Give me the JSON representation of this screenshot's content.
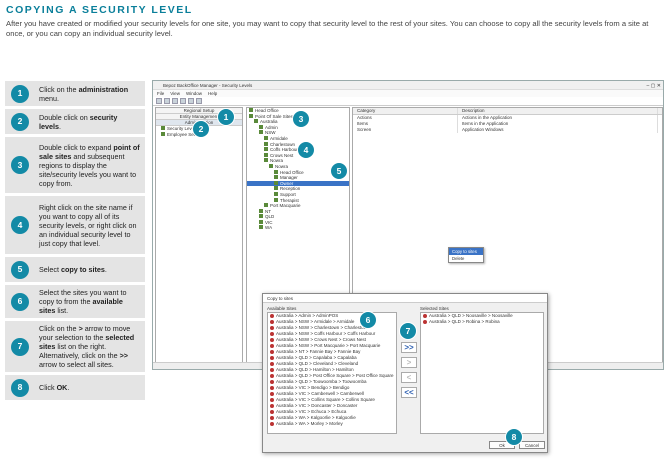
{
  "title": "COPYING A SECURITY LEVEL",
  "intro": "After you have created or modified your security levels for one site, you may want to copy that security level to the rest of your sites. You can choose to copy all the security levels from a site at once, or you can copy an individual security level.",
  "steps": [
    {
      "num": "1",
      "parts": [
        {
          "t": "Click on the "
        },
        {
          "t": "administration",
          "b": true
        },
        {
          "t": " menu."
        }
      ]
    },
    {
      "num": "2",
      "parts": [
        {
          "t": "Double click on "
        },
        {
          "t": "security levels",
          "b": true
        },
        {
          "t": "."
        }
      ]
    },
    {
      "num": "3",
      "parts": [
        {
          "t": "Double click to expand "
        },
        {
          "t": "point of sale sites",
          "b": true
        },
        {
          "t": " and subsequent regions to display the site/security levels you want to copy from."
        }
      ]
    },
    {
      "num": "4",
      "parts": [
        {
          "t": "Right click on the site name if you want to copy all of its security levels, or right click on an individual security level to just copy that level."
        }
      ]
    },
    {
      "num": "5",
      "parts": [
        {
          "t": "Select "
        },
        {
          "t": "copy to sites",
          "b": true
        },
        {
          "t": "."
        }
      ]
    },
    {
      "num": "6",
      "parts": [
        {
          "t": "Select the sites you want to copy to from the "
        },
        {
          "t": "available sites",
          "b": true
        },
        {
          "t": " list."
        }
      ]
    },
    {
      "num": "7",
      "parts": [
        {
          "t": "Click on the "
        },
        {
          "t": ">",
          "b": true
        },
        {
          "t": " arrow to move your selection to the "
        },
        {
          "t": "selected sites",
          "b": true
        },
        {
          "t": " list on the right. Alternatively, click on the "
        },
        {
          "t": ">>",
          "b": true
        },
        {
          "t": " arrow to select all sites."
        }
      ]
    },
    {
      "num": "8",
      "parts": [
        {
          "t": "Click "
        },
        {
          "t": "OK",
          "b": true
        },
        {
          "t": "."
        }
      ]
    }
  ],
  "app": {
    "window_title": "Bepoz BackOffice Manager - Security Levels",
    "menu": [
      "File",
      "View",
      "Window",
      "Help"
    ],
    "left_headers": [
      "Regional Setup",
      "Entity Management",
      "Administration"
    ],
    "left_items": [
      "Security Levels",
      "Employee Security"
    ],
    "tree": [
      {
        "t": "Head Office",
        "d": 0
      },
      {
        "t": "Point Of Sale Sites",
        "d": 0
      },
      {
        "t": "Australia",
        "d": 1
      },
      {
        "t": "Admin",
        "d": 2
      },
      {
        "t": "NSW",
        "d": 2
      },
      {
        "t": "Armidale",
        "d": 3
      },
      {
        "t": "Charlestown",
        "d": 3
      },
      {
        "t": "Coffs Harbour",
        "d": 3
      },
      {
        "t": "Crows Nest",
        "d": 3
      },
      {
        "t": "Nowra",
        "d": 3
      },
      {
        "t": "Nowra",
        "d": 4
      },
      {
        "t": "Head Office",
        "d": 5
      },
      {
        "t": "Manager",
        "d": 5
      },
      {
        "t": "Owner",
        "d": 5,
        "hl": true
      },
      {
        "t": "Reception",
        "d": 5
      },
      {
        "t": "Support",
        "d": 5
      },
      {
        "t": "Therapist",
        "d": 5
      },
      {
        "t": "Port Macquarie",
        "d": 3
      },
      {
        "t": "NT",
        "d": 2
      },
      {
        "t": "QLD",
        "d": 2
      },
      {
        "t": "VIC",
        "d": 2
      },
      {
        "t": "WA",
        "d": 2
      }
    ],
    "grid_headers": [
      "Category",
      "Description"
    ],
    "grid_rows": [
      [
        "Actions",
        "Actions in the Application"
      ],
      [
        "Items",
        "Items in the Application"
      ],
      [
        "Screen",
        "Application Windows"
      ]
    ],
    "context_menu": [
      "Copy to sites",
      "Delete"
    ],
    "status": "BEPOZ ADMIN   Wed, Jan 18, 2017"
  },
  "dialog": {
    "title": "Copy to sites",
    "available_label": "Available Sites",
    "selected_label": "Selected Sites",
    "available": [
      "Australia > Admin > AdminPOS",
      "Australia > NSW > Armidale > Armidale",
      "Australia > NSW > Charlestown > Charlestown",
      "Australia > NSW > Coffs Harbour > Coffs Harbour",
      "Australia > NSW > Crows Nest > Crows Nest",
      "Australia > NSW > Port Macquarie > Port Macquarie",
      "Australia > NT > Fannie Bay > Fannie Bay",
      "Australia > QLD > Capalaba > Capalaba",
      "Australia > QLD > Cleveland > Cleveland",
      "Australia > QLD > Hamilton > Hamilton",
      "Australia > QLD > Post Office Square > Post Office Square",
      "Australia > QLD > Toowoomba > Toowoomba",
      "Australia > VIC > Bendigo > Bendigo",
      "Australia > VIC > Camberwell > Camberwell",
      "Australia > VIC > Collins Square > Collins Square",
      "Australia > VIC > Doncaster > Doncaster",
      "Australia > VIC > Echuca > Echuca",
      "Australia > WA > Kalgoorlie > Kalgoorlie",
      "Australia > WA > Morley > Morley"
    ],
    "selected": [
      "Australia > QLD > Noosaville > Noosaville",
      "Australia > QLD > Robina > Robina"
    ],
    "buttons": {
      "add": ">",
      "add_all": ">>",
      "remove": "<",
      "remove_all": "<<",
      "ok": "Ok",
      "cancel": "Cancel"
    }
  },
  "callouts": [
    "1",
    "2",
    "3",
    "4",
    "5",
    "6",
    "7",
    "8"
  ],
  "colors": {
    "accent": "#138aa6",
    "title": "#0a7f9a",
    "step_bg": "#e4e4e4"
  }
}
